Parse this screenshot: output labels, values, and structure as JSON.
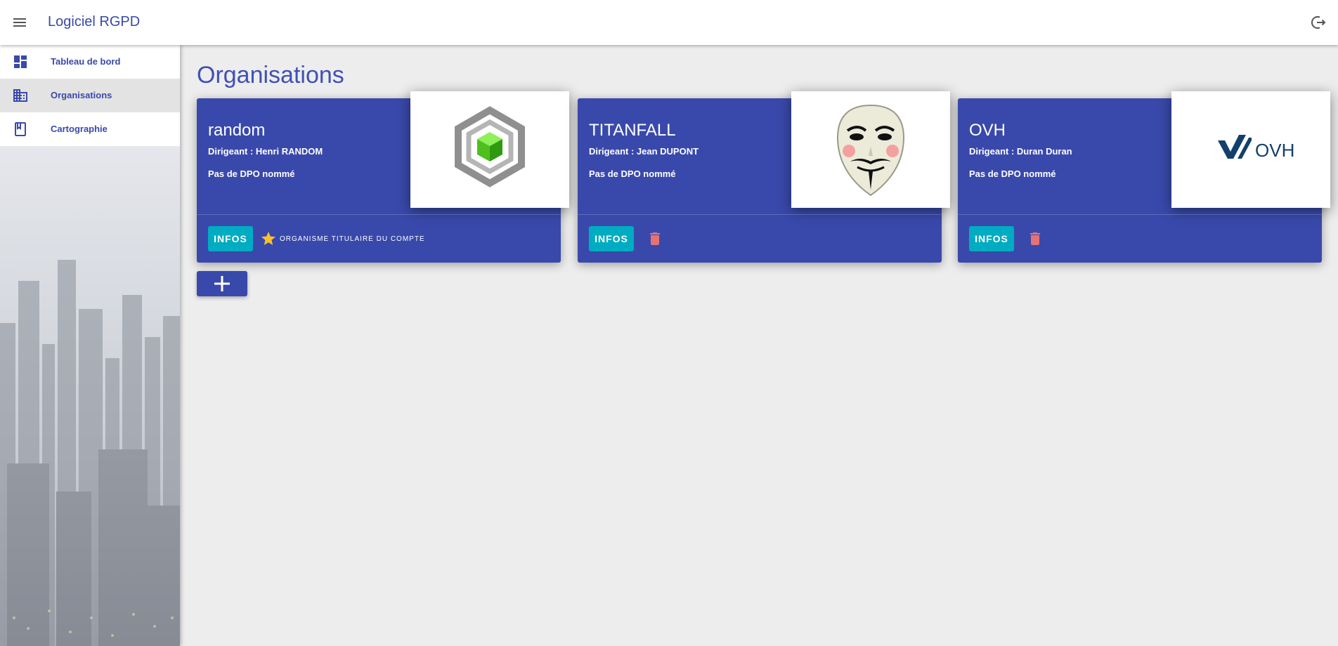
{
  "app": {
    "title": "Logiciel RGPD"
  },
  "colors": {
    "primary": "#3949ab",
    "accent": "#00acc1",
    "danger": "#e57373",
    "star": "#fbc02d"
  },
  "icons": {
    "menu": "menu-icon",
    "logout": "logout-icon"
  },
  "sidebar": {
    "items": [
      {
        "label": "Tableau de bord",
        "icon": "dashboard-icon"
      },
      {
        "label": "Organisations",
        "icon": "business-icon",
        "active": true
      },
      {
        "label": "Cartographie",
        "icon": "book-icon"
      }
    ]
  },
  "main": {
    "title": "Organisations",
    "cards": [
      {
        "name": "random",
        "director": "Dirigeant : Henri RANDOM",
        "dpo": "Pas de DPO nommé",
        "infos_label": "INFOS",
        "owner_label": "ORGANISME TITULAIRE DU COMPTE",
        "logo": "hexagon-cube-logo"
      },
      {
        "name": "TITANFALL",
        "director": "Dirigeant : Jean DUPONT",
        "dpo": "Pas de DPO nommé",
        "infos_label": "INFOS",
        "logo": "guy-fawkes-mask-logo"
      },
      {
        "name": "OVH",
        "director": "Dirigeant : Duran Duran",
        "dpo": "Pas de DPO nommé",
        "infos_label": "INFOS",
        "logo": "ovh-logo",
        "logo_text": "OVH"
      }
    ],
    "add_button": "add-icon"
  }
}
